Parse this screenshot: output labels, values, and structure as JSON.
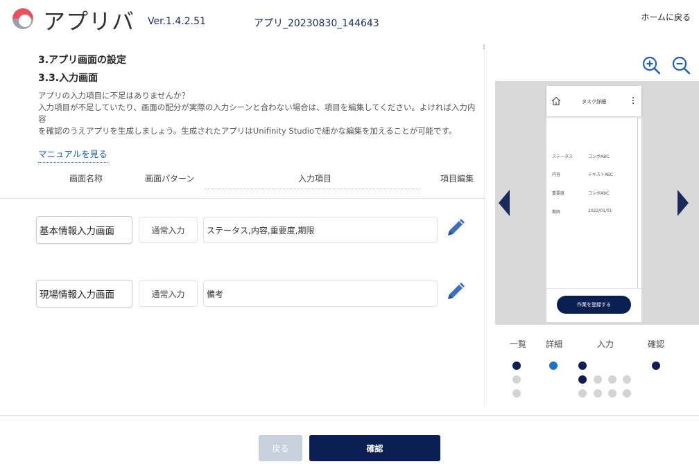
{
  "header": {
    "app_name": "アプリバ",
    "version": "Ver.1.4.2.51",
    "filename": "アプリ_20230830_144643",
    "home_link": "ホームに戻る"
  },
  "main": {
    "section_title": "3.アプリ画面の設定",
    "sub_title": "3.3.入力画面",
    "description_lines": [
      "アプリの入力項目に不足はありませんか？",
      "入力項目が不足していたり、画面の配分が実際の入力シーンと合わない場合は、項目を編集してください。よければ入力内容",
      "を確認のうえアプリを生成しましょう。生成されたアプリはUnifinity Studioで細かな編集を加えることが可能です。"
    ],
    "manual_link": "マニュアルを見る",
    "columns": {
      "name": "画面名称",
      "pattern": "画面パターン",
      "items": "入力項目",
      "edit": "項目編集"
    },
    "rows": [
      {
        "name": "基本情報入力画面",
        "pattern": "通常入力",
        "items": "ステータス,内容,重要度,期限"
      },
      {
        "name": "現場情報入力画面",
        "pattern": "通常入力",
        "items": "備考"
      }
    ]
  },
  "preview": {
    "phone_title": "タスク詳細",
    "fields": [
      {
        "key": "ステータス",
        "value": "コンボABC"
      },
      {
        "key": "内容",
        "value": "テキストABC"
      },
      {
        "key": "重要度",
        "value": "コンボABC"
      },
      {
        "key": "期限",
        "value": "2022/01/01"
      }
    ],
    "button_label": "作業を登録する"
  },
  "steps": {
    "labels": [
      "一覧",
      "詳細",
      "入力",
      "確認"
    ]
  },
  "footer": {
    "back_label": "戻る",
    "confirm_label": "確認"
  },
  "colors": {
    "navy": "#0b1f54",
    "active_step": "#1f72c2",
    "logo_red": "#e8505b",
    "link_blue": "#1a5fb4",
    "edit_icon_blue": "#3d6fbf"
  }
}
